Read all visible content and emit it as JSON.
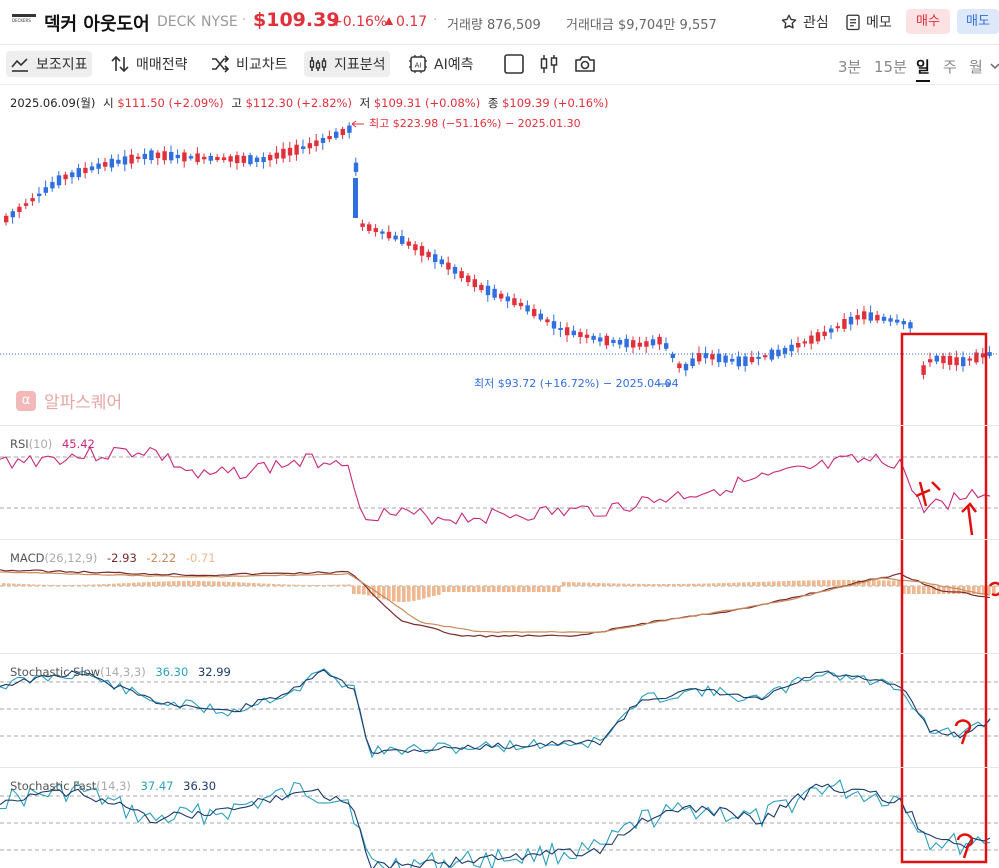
{
  "header": {
    "logo_text": "DECKERS",
    "name": "덱커 아웃도어",
    "ticker": "DECK",
    "exchange": "NYSE",
    "price": "$109.39",
    "change_pct": "+0.16%",
    "change_abs": "0.17",
    "volume": "거래량 876,509",
    "amount": "거래대금 $9,704만 9,557",
    "watch_label": "관심",
    "memo_label": "메모",
    "buy_label": "매수",
    "sell_label": "매도"
  },
  "toolbar": {
    "aux_indicator": "보조지표",
    "trading_strategy": "매매전략",
    "compare_chart": "비교차트",
    "indicator_analysis": "지표분석",
    "ai_forecast": "AI예측",
    "timeframes": [
      "3분",
      "15분",
      "일",
      "주",
      "월"
    ],
    "selected_timeframe": "일"
  },
  "ohlc_info": {
    "date": "2025.06.09(월)",
    "open_label": "시",
    "open": "$111.50 (+2.09%)",
    "high_label": "고",
    "high": "$112.30 (+2.82%)",
    "low_label": "저",
    "low": "$109.31 (+0.08%)",
    "close_label": "종",
    "close": "$109.39 (+0.16%)"
  },
  "annotations": {
    "high_note": "최고 $223.98 (−51.16%) − 2025.01.30",
    "low_note": "최저 $93.72 (+16.72%) − 2025.04.04"
  },
  "watermark": "알파스퀘어",
  "indicators": {
    "rsi": {
      "name": "RSI",
      "params": "(10)",
      "value": "45.42"
    },
    "macd": {
      "name": "MACD",
      "params": "(26,12,9)",
      "v1": "-2.93",
      "v2": "-2.22",
      "v3": "-0.71"
    },
    "stoch_slow": {
      "name": "Stochastic Slow",
      "params": "(14,3,3)",
      "v1": "36.30",
      "v2": "32.99"
    },
    "stoch_fast": {
      "name": "Stochastic Fast",
      "params": "(14,3)",
      "v1": "37.47",
      "v2": "36.30"
    }
  },
  "colors": {
    "up": "#e0303a",
    "down": "#2f6fdf",
    "rsi_line": "#c8287a",
    "macd_line": "#7a2a2a",
    "macd_signal": "#c98a5a",
    "macd_hist": "#f0b890",
    "stoch_k": "#2a9fbf",
    "stoch_d": "#1a3a6a",
    "annotation_box": "#e01010"
  }
}
